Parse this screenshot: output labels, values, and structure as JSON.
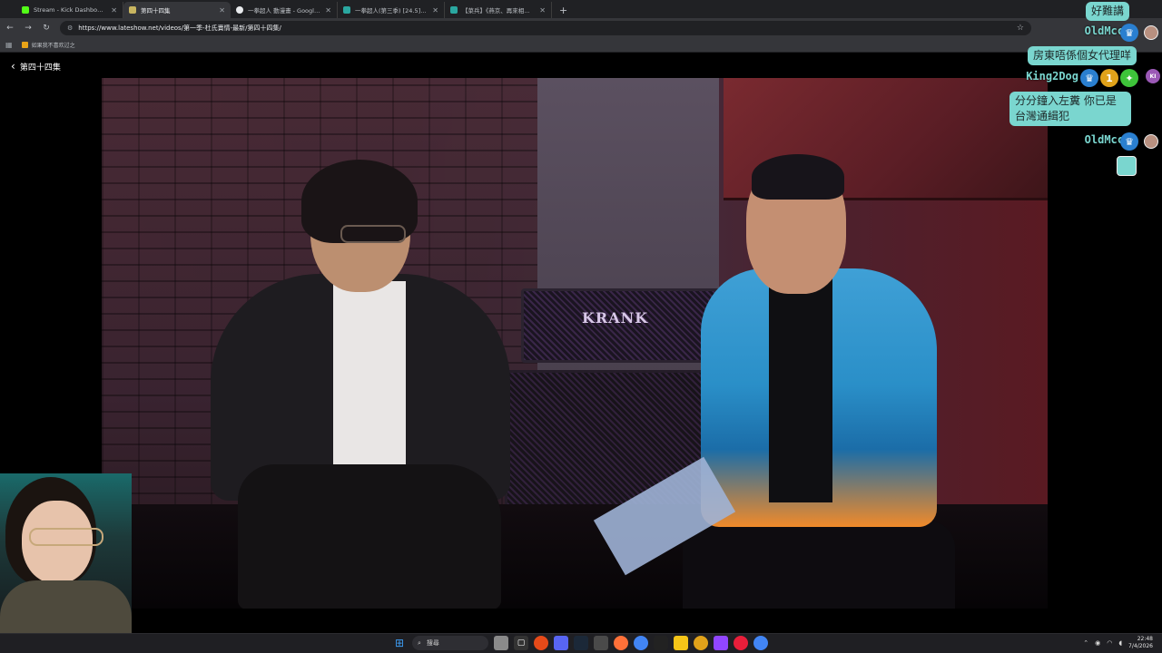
{
  "browser": {
    "tabs": [
      {
        "title": "Stream - Kick Dashboard",
        "favicon_color": "#53fc18",
        "active": false
      },
      {
        "title": "第四十四集",
        "favicon_color": "#c8b560",
        "active": true
      },
      {
        "title": "一拳超人 動漫畫 - Google 搜尋",
        "favicon_color": "#e8eaed",
        "active": false
      },
      {
        "title": "一拳超人(第三季) [24.5] 真上市",
        "favicon_color": "#2aa7a0",
        "active": false
      },
      {
        "title": "【菜兵】《燕京、再來相戀 - 》",
        "favicon_color": "#2aa7a0",
        "active": false
      }
    ],
    "new_tab_label": "+",
    "url": "https://www.lateshow.net/videos/第一季-杜氏賣情-最新/第四十四集/",
    "bookmark": "如果我不喜欢过之"
  },
  "page": {
    "back_label": "第四十四集",
    "video": {
      "amp_brand": "KRANK"
    }
  },
  "chat": {
    "messages": [
      {
        "text": "好難講",
        "user": "OldMcc"
      },
      {
        "text": "房東唔係個女代理咩",
        "user": "King2Dog"
      },
      {
        "text": "分分鐘入左糞 你已是台灣通緝犯",
        "user": "OldMcc"
      }
    ],
    "badge_number": "1"
  },
  "taskbar": {
    "search_label": "搜尋",
    "time": "22:48",
    "date": "7/4/2026"
  },
  "colors": {
    "chat_accent": "#7ad6cf",
    "kick_green": "#53fc18"
  }
}
